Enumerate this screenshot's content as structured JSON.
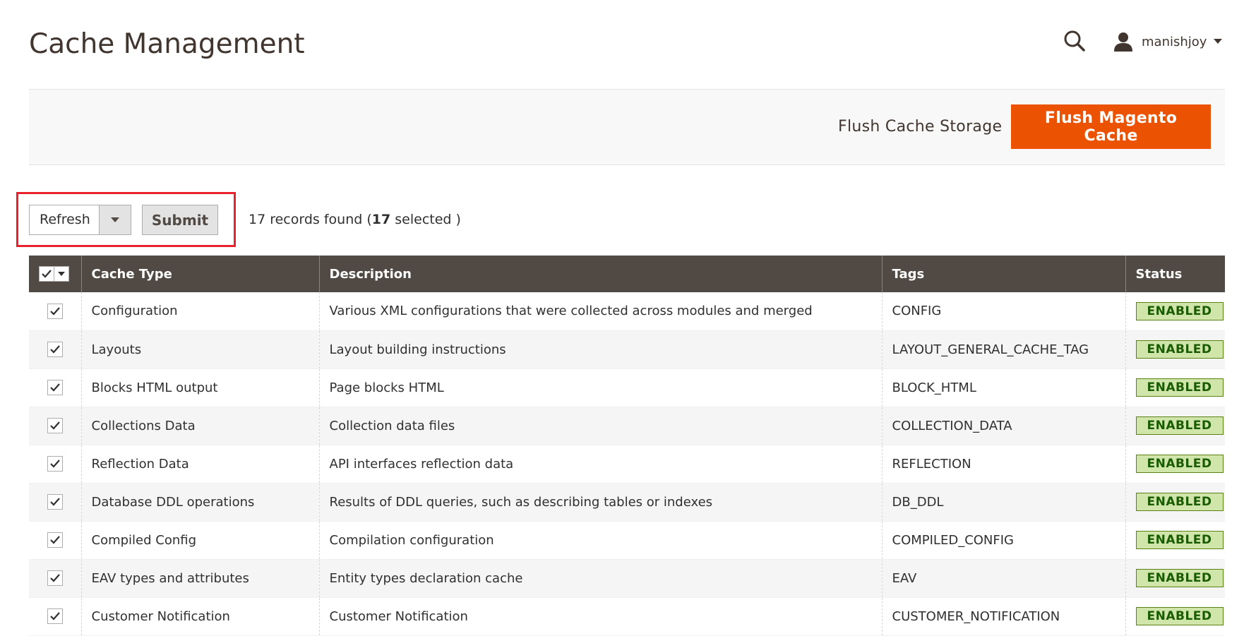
{
  "header": {
    "title": "Cache Management",
    "user": {
      "name": "manishjoy"
    }
  },
  "actions": {
    "flush_storage_label": "Flush Cache Storage",
    "flush_magento_label": "Flush Magento Cache"
  },
  "toolbar": {
    "mass_action_selected": "Refresh",
    "submit_label": "Submit",
    "records_prefix": "17 records found (",
    "selected_count": "17",
    "records_suffix": " selected )"
  },
  "grid": {
    "columns": [
      "Cache Type",
      "Description",
      "Tags",
      "Status"
    ],
    "rows": [
      {
        "type": "Configuration",
        "description": "Various XML configurations that were collected across modules and merged",
        "tags": "CONFIG",
        "status": "ENABLED"
      },
      {
        "type": "Layouts",
        "description": "Layout building instructions",
        "tags": "LAYOUT_GENERAL_CACHE_TAG",
        "status": "ENABLED"
      },
      {
        "type": "Blocks HTML output",
        "description": "Page blocks HTML",
        "tags": "BLOCK_HTML",
        "status": "ENABLED"
      },
      {
        "type": "Collections Data",
        "description": "Collection data files",
        "tags": "COLLECTION_DATA",
        "status": "ENABLED"
      },
      {
        "type": "Reflection Data",
        "description": "API interfaces reflection data",
        "tags": "REFLECTION",
        "status": "ENABLED"
      },
      {
        "type": "Database DDL operations",
        "description": "Results of DDL queries, such as describing tables or indexes",
        "tags": "DB_DDL",
        "status": "ENABLED"
      },
      {
        "type": "Compiled Config",
        "description": "Compilation configuration",
        "tags": "COMPILED_CONFIG",
        "status": "ENABLED"
      },
      {
        "type": "EAV types and attributes",
        "description": "Entity types declaration cache",
        "tags": "EAV",
        "status": "ENABLED"
      },
      {
        "type": "Customer Notification",
        "description": "Customer Notification",
        "tags": "CUSTOMER_NOTIFICATION",
        "status": "ENABLED"
      }
    ]
  },
  "colors": {
    "primary_button": "#eb5202",
    "grid_header": "#514943",
    "status_bg": "#d0e5a9",
    "status_text": "#185b00",
    "highlight": "#e8212c"
  },
  "icons": [
    "search-icon",
    "user-icon",
    "caret-down-icon",
    "checkmark-icon"
  ]
}
